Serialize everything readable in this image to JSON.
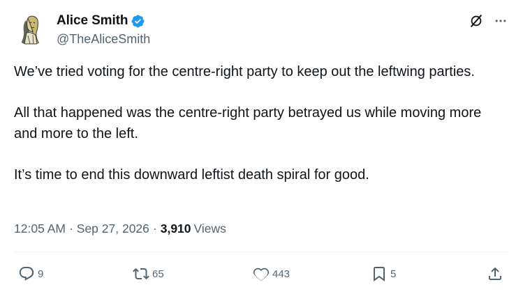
{
  "author": {
    "display_name": "Alice Smith",
    "handle": "@TheAliceSmith",
    "verified": true,
    "avatar_icon": "avatar-illustration"
  },
  "top_icons": {
    "grok": "grok-icon",
    "more": "more-icon"
  },
  "post": {
    "paragraphs": [
      "We’ve tried voting for the centre-right party to keep out the leftwing parties.",
      "All that happened was the centre-right party betrayed us while moving more and more to the left.",
      "It’s time to end this downward leftist death spiral for good."
    ]
  },
  "meta": {
    "time": "12:05 AM",
    "separator": "·",
    "date": "Sep 27, 2026",
    "views_count": "3,910",
    "views_label": "Views"
  },
  "actions": {
    "replies": "9",
    "reposts": "65",
    "likes": "443",
    "bookmarks": "5"
  },
  "colors": {
    "text": "#0f1419",
    "secondary": "#536471",
    "verified": "#1d9bf0",
    "divider": "#eff3f4"
  }
}
